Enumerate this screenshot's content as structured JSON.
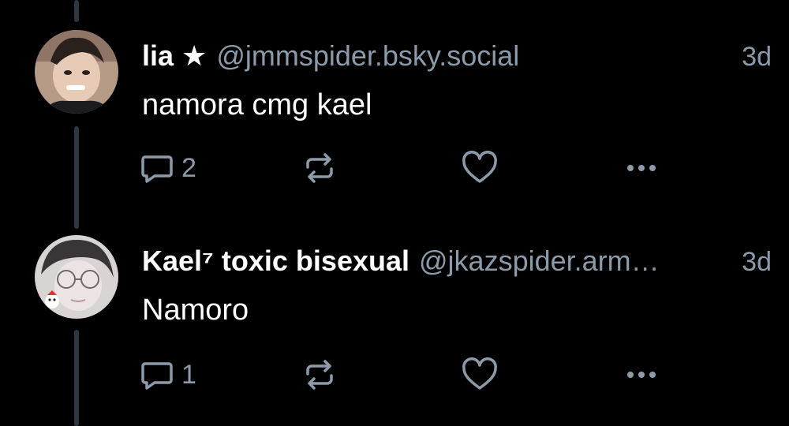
{
  "posts": [
    {
      "name": "lia ★",
      "handle": "@jmmspider.bsky.social",
      "time": "3d",
      "text": "namora cmg kael",
      "reply_count": "2"
    },
    {
      "name": "Kael⁷ toxic bisexual",
      "handle": "@jkazspider.arm…",
      "time": "3d",
      "text": "Namoro",
      "reply_count": "1"
    }
  ],
  "colors": {
    "background": "#000000",
    "text_primary": "#ffffff",
    "text_secondary": "#8c9aa9",
    "thread_line": "#2e3640"
  },
  "icons": [
    "reply-icon",
    "repost-icon",
    "like-icon",
    "more-options-icon"
  ]
}
